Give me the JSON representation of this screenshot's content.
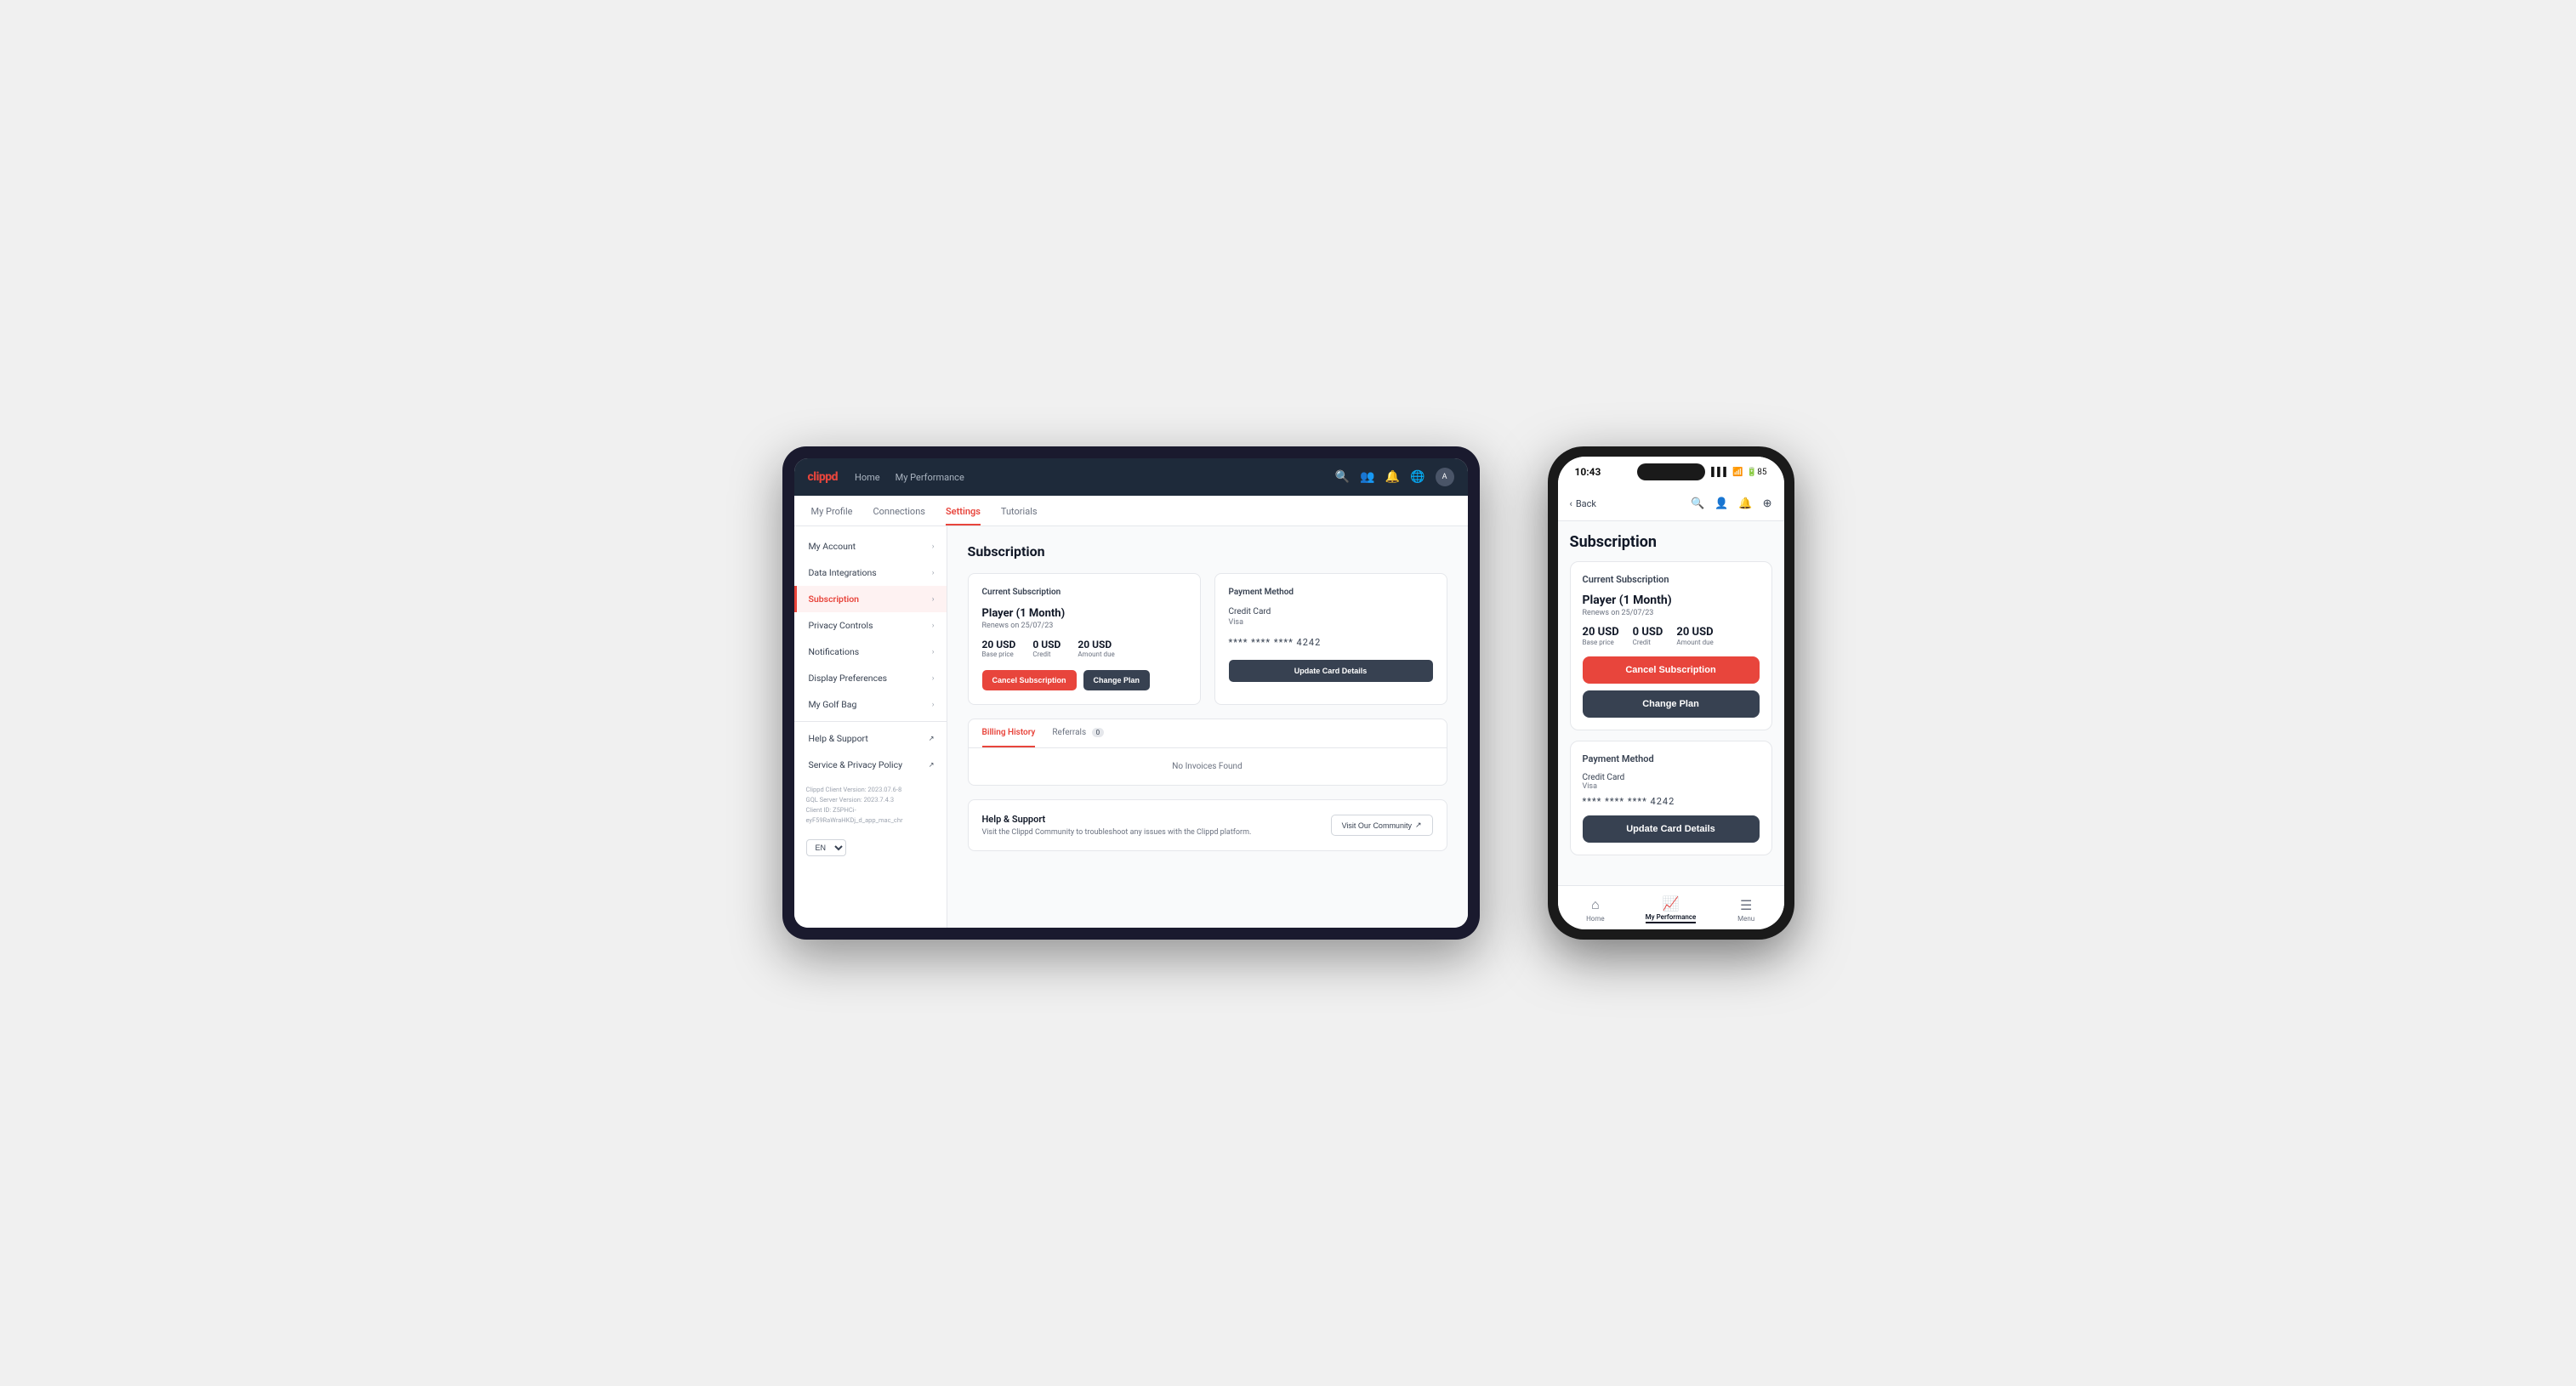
{
  "tablet": {
    "logo": "clippd",
    "nav_links": [
      "Home",
      "My Performance"
    ],
    "subnav_items": [
      "My Profile",
      "Connections",
      "Settings",
      "Tutorials"
    ],
    "active_subnav": "Settings",
    "sidebar_items": [
      {
        "label": "My Account",
        "active": false
      },
      {
        "label": "Data Integrations",
        "active": false
      },
      {
        "label": "Subscription",
        "active": true
      },
      {
        "label": "Privacy Controls",
        "active": false
      },
      {
        "label": "Notifications",
        "active": false
      },
      {
        "label": "Display Preferences",
        "active": false
      },
      {
        "label": "My Golf Bag",
        "active": false
      },
      {
        "label": "Help & Support",
        "active": false
      },
      {
        "label": "Service & Privacy Policy",
        "active": false
      }
    ],
    "footer_text": "Clippd Client Version: 2023.07.6-8\nGQL Server Version: 2023.7.4.3\nClient ID: Z5PHCi-eyF59RaWraHKDj_d_app_mac_chr",
    "lang_option": "EN",
    "content": {
      "title": "Subscription",
      "current_subscription": {
        "section_title": "Current Subscription",
        "plan_name": "Player (1 Month)",
        "renews": "Renews on 25/07/23",
        "base_price": "20 USD",
        "base_price_label": "Base price",
        "credit": "0 USD",
        "credit_label": "Credit",
        "amount_due": "20 USD",
        "amount_due_label": "Amount due",
        "btn_cancel": "Cancel Subscription",
        "btn_change": "Change Plan"
      },
      "payment_method": {
        "section_title": "Payment Method",
        "card_label": "Credit Card",
        "card_type": "Visa",
        "card_number": "**** **** **** 4242",
        "btn_update": "Update Card Details"
      },
      "billing": {
        "tab_history": "Billing History",
        "tab_referrals": "Referrals",
        "referrals_count": "0",
        "empty_message": "No Invoices Found"
      },
      "help": {
        "title": "Help & Support",
        "description": "Visit the Clippd Community to troubleshoot any issues with the Clippd platform.",
        "btn_community": "Visit Our Community",
        "btn_icon": "↗"
      }
    }
  },
  "phone": {
    "status_bar": {
      "time": "10:43",
      "signal": "▌▌▌",
      "wifi": "WiFi",
      "battery": "85"
    },
    "nav": {
      "back_label": "Back",
      "icons": [
        "search",
        "person",
        "bell",
        "plus"
      ]
    },
    "content": {
      "title": "Subscription",
      "current_subscription": {
        "section_title": "Current Subscription",
        "plan_name": "Player (1 Month)",
        "renews": "Renews on 25/07/23",
        "base_price": "20 USD",
        "base_price_label": "Base price",
        "credit": "0 USD",
        "credit_label": "Credit",
        "amount_due": "20 USD",
        "amount_due_label": "Amount due",
        "btn_cancel": "Cancel Subscription",
        "btn_change": "Change Plan"
      },
      "payment_method": {
        "section_title": "Payment Method",
        "card_label": "Credit Card",
        "card_type": "Visa",
        "card_number": "**** **** **** 4242",
        "btn_update": "Update Card Details"
      }
    },
    "bottom_nav": [
      {
        "label": "Home",
        "icon": "⌂",
        "active": false
      },
      {
        "label": "My Performance",
        "icon": "📈",
        "active": true
      },
      {
        "label": "Menu",
        "icon": "☰",
        "active": false
      }
    ]
  }
}
